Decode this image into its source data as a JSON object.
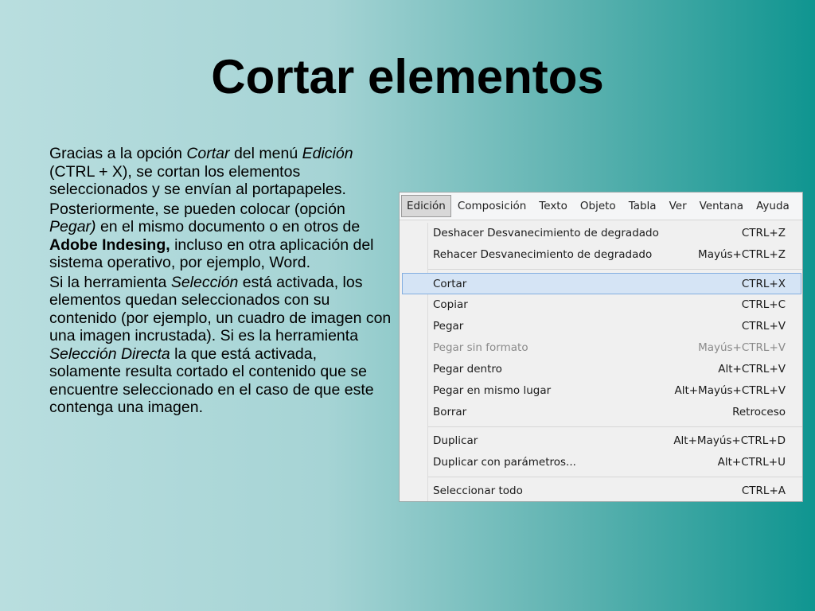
{
  "slide": {
    "title": "Cortar elementos"
  },
  "body": {
    "paragraph1": [
      {
        "text": "Gracias a la opción ",
        "style": "normal"
      },
      {
        "text": "Cortar",
        "style": "italic"
      },
      {
        "text": " del menú ",
        "style": "normal"
      },
      {
        "text": "Edición",
        "style": "italic"
      },
      {
        "text": " (CTRL + X), se cortan los elementos seleccionados y se envían al portapapeles.",
        "style": "normal"
      }
    ],
    "paragraph2": [
      {
        "text": "Posteriormente, se pueden colocar (opción ",
        "style": "normal"
      },
      {
        "text": "Pegar)",
        "style": "italic"
      },
      {
        "text": " en el mismo documento o en otros de ",
        "style": "normal"
      },
      {
        "text": "Adobe Indesing,",
        "style": "bold"
      },
      {
        "text": " incluso en otra aplicación del sistema operativo, por ejemplo, Word.",
        "style": "normal"
      }
    ],
    "paragraph3": [
      {
        "text": "Si la herramienta ",
        "style": "normal"
      },
      {
        "text": "Selección",
        "style": "italic"
      },
      {
        "text": " está activada, los elementos quedan seleccionados con su contenido (por ejemplo, un cuadro de imagen con una imagen incrustada). Si es la herramienta ",
        "style": "normal"
      },
      {
        "text": "Selección Directa",
        "style": "italic"
      },
      {
        "text": " la que está activada, solamente resulta cortado el contenido que se encuentre seleccionado en el caso de que este contenga una imagen.",
        "style": "normal"
      }
    ]
  },
  "menubar": {
    "items": [
      "Edición",
      "Composición",
      "Texto",
      "Objeto",
      "Tabla",
      "Ver",
      "Ventana",
      "Ayuda"
    ]
  },
  "menu": {
    "groups": [
      [
        {
          "label": "Deshacer Desvanecimiento de degradado",
          "shortcut": "CTRL+Z"
        },
        {
          "label": "Rehacer Desvanecimiento de degradado",
          "shortcut": "Mayús+CTRL+Z"
        }
      ],
      [
        {
          "label": "Cortar",
          "shortcut": "CTRL+X",
          "selected": true
        },
        {
          "label": "Copiar",
          "shortcut": "CTRL+C"
        },
        {
          "label": "Pegar",
          "shortcut": "CTRL+V"
        },
        {
          "label": "Pegar sin formato",
          "shortcut": "Mayús+CTRL+V",
          "disabled": true
        },
        {
          "label": "Pegar dentro",
          "shortcut": "Alt+CTRL+V"
        },
        {
          "label": "Pegar en mismo lugar",
          "shortcut": "Alt+Mayús+CTRL+V"
        },
        {
          "label": "Borrar",
          "shortcut": "Retroceso"
        }
      ],
      [
        {
          "label": "Duplicar",
          "shortcut": "Alt+Mayús+CTRL+D"
        },
        {
          "label": "Duplicar con parámetros...",
          "shortcut": "Alt+CTRL+U"
        }
      ],
      [
        {
          "label": "Seleccionar todo",
          "shortcut": "CTRL+A"
        }
      ]
    ]
  }
}
